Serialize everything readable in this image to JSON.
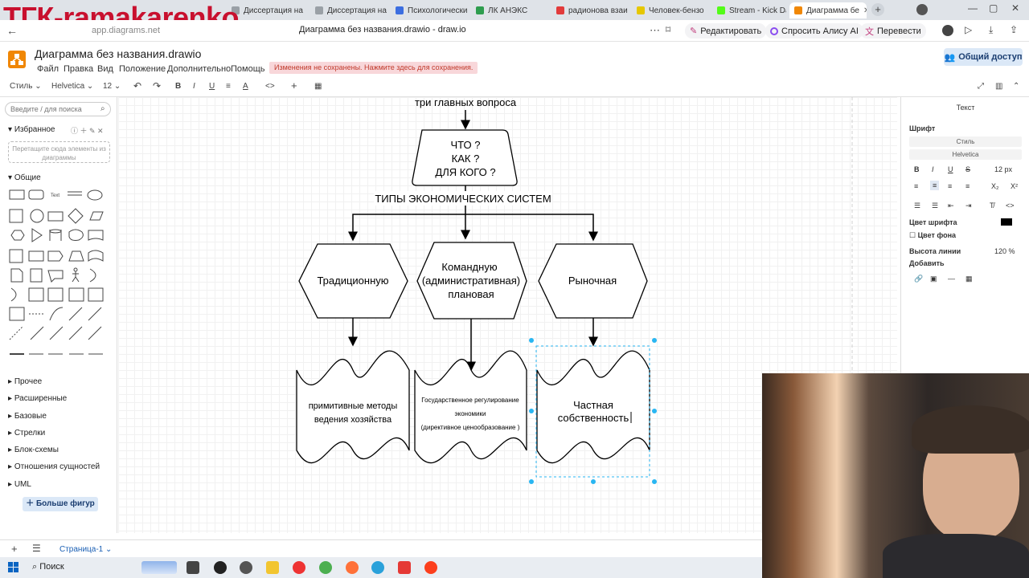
{
  "watermark": "ТГК-ramakarenko",
  "browser": {
    "tabs": [
      {
        "label": "Диссертация на",
        "color": "#9aa0a6"
      },
      {
        "label": "Диссертация на",
        "color": "#9aa0a6"
      },
      {
        "label": "Психологически",
        "color": "#3c6ee0"
      },
      {
        "label": "ЛК АНЭКС",
        "color": "#2e9d4e"
      },
      {
        "label": "радионова взаи",
        "color": "#e23b3b"
      },
      {
        "label": "Человек-бензо",
        "color": "#e6c700"
      },
      {
        "label": "Stream - Kick Das",
        "color": "#53fc18"
      },
      {
        "label": "Диаграмма бе",
        "color": "#f08705"
      }
    ],
    "url": "app.diagrams.net",
    "page_title": "Диаграмма без названия.drawio - draw.io",
    "actions": {
      "edit": "Редактировать",
      "ask_alice": "Спросить Алису AI",
      "translate": "Перевести"
    }
  },
  "app": {
    "doc_title": "Диаграмма без названия.drawio",
    "menu": [
      "Файл",
      "Правка",
      "Вид",
      "Положение",
      "Дополнительно",
      "Помощь"
    ],
    "unsaved_notice": "Изменения не сохранены. Нажмите здесь для сохранения.",
    "share_label": "Общий доступ"
  },
  "toolbar": {
    "style": "Стиль",
    "font": "Helvetica",
    "size": "12"
  },
  "sidebar": {
    "search_placeholder": "Введите / для поиска",
    "favorites": "Избранное",
    "drop_hint": "Перетащите сюда элементы из диаграммы",
    "general": "Общие",
    "sections": [
      "Прочее",
      "Расширенные",
      "Базовые",
      "Стрелки",
      "Блок-схемы",
      "Отношения сущностей",
      "UML"
    ],
    "more_shapes": "Больше фигур"
  },
  "diagram": {
    "top_text": "три главных вопроса",
    "question_lines": [
      "ЧТО ?",
      "КАК ?",
      "ДЛЯ КОГО ?"
    ],
    "types_label": "ТИПЫ ЭКОНОМИЧЕСКИХ СИСТЕМ",
    "traditional": "Традиционную",
    "command_lines": [
      "Командную",
      "(административная)",
      "плановая"
    ],
    "market": "Рыночная",
    "trad_desc_lines": [
      "примитивные методы",
      "ведения хозяйства"
    ],
    "command_desc_lines": [
      "Государственное регулирование",
      "экономики",
      "(директивное ценообразование )"
    ],
    "market_desc_lines": [
      "Частная",
      "собственность"
    ]
  },
  "format": {
    "title": "Текст",
    "font_section": "Шрифт",
    "style_select": "Стиль",
    "font_select": "Helvetica",
    "font_size": "12 px",
    "font_color": "Цвет шрифта",
    "bg_color": "Цвет фона",
    "line_height": "Высота линии",
    "line_height_value": "120 %",
    "add": "Добавить"
  },
  "pagebar": {
    "page": "Страница-1"
  },
  "taskbar": {
    "search": "Поиск"
  }
}
